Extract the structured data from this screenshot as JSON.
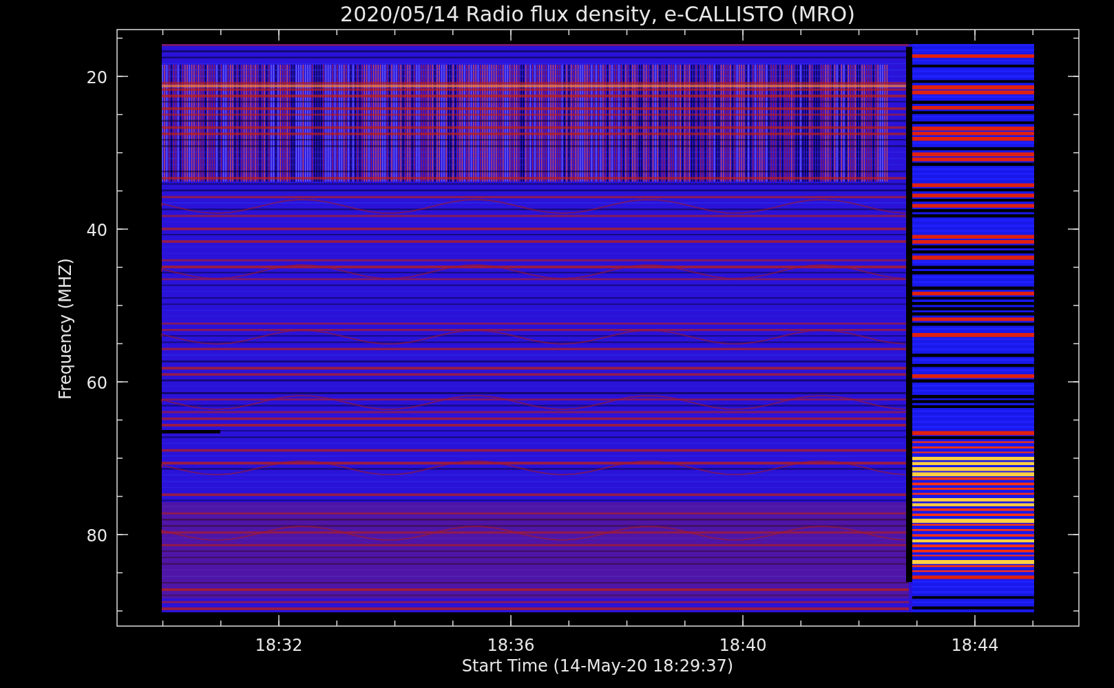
{
  "title": "2020/05/14  Radio flux density, e-CALLISTO (MRO)",
  "y_axis": {
    "label": "Frequency (MHZ)",
    "ticks": [
      "20",
      "40",
      "60",
      "80"
    ]
  },
  "x_axis": {
    "label": "Start Time (14-May-20 18:29:37)",
    "ticks": [
      "18:32",
      "18:36",
      "18:40",
      "18:44"
    ]
  }
}
